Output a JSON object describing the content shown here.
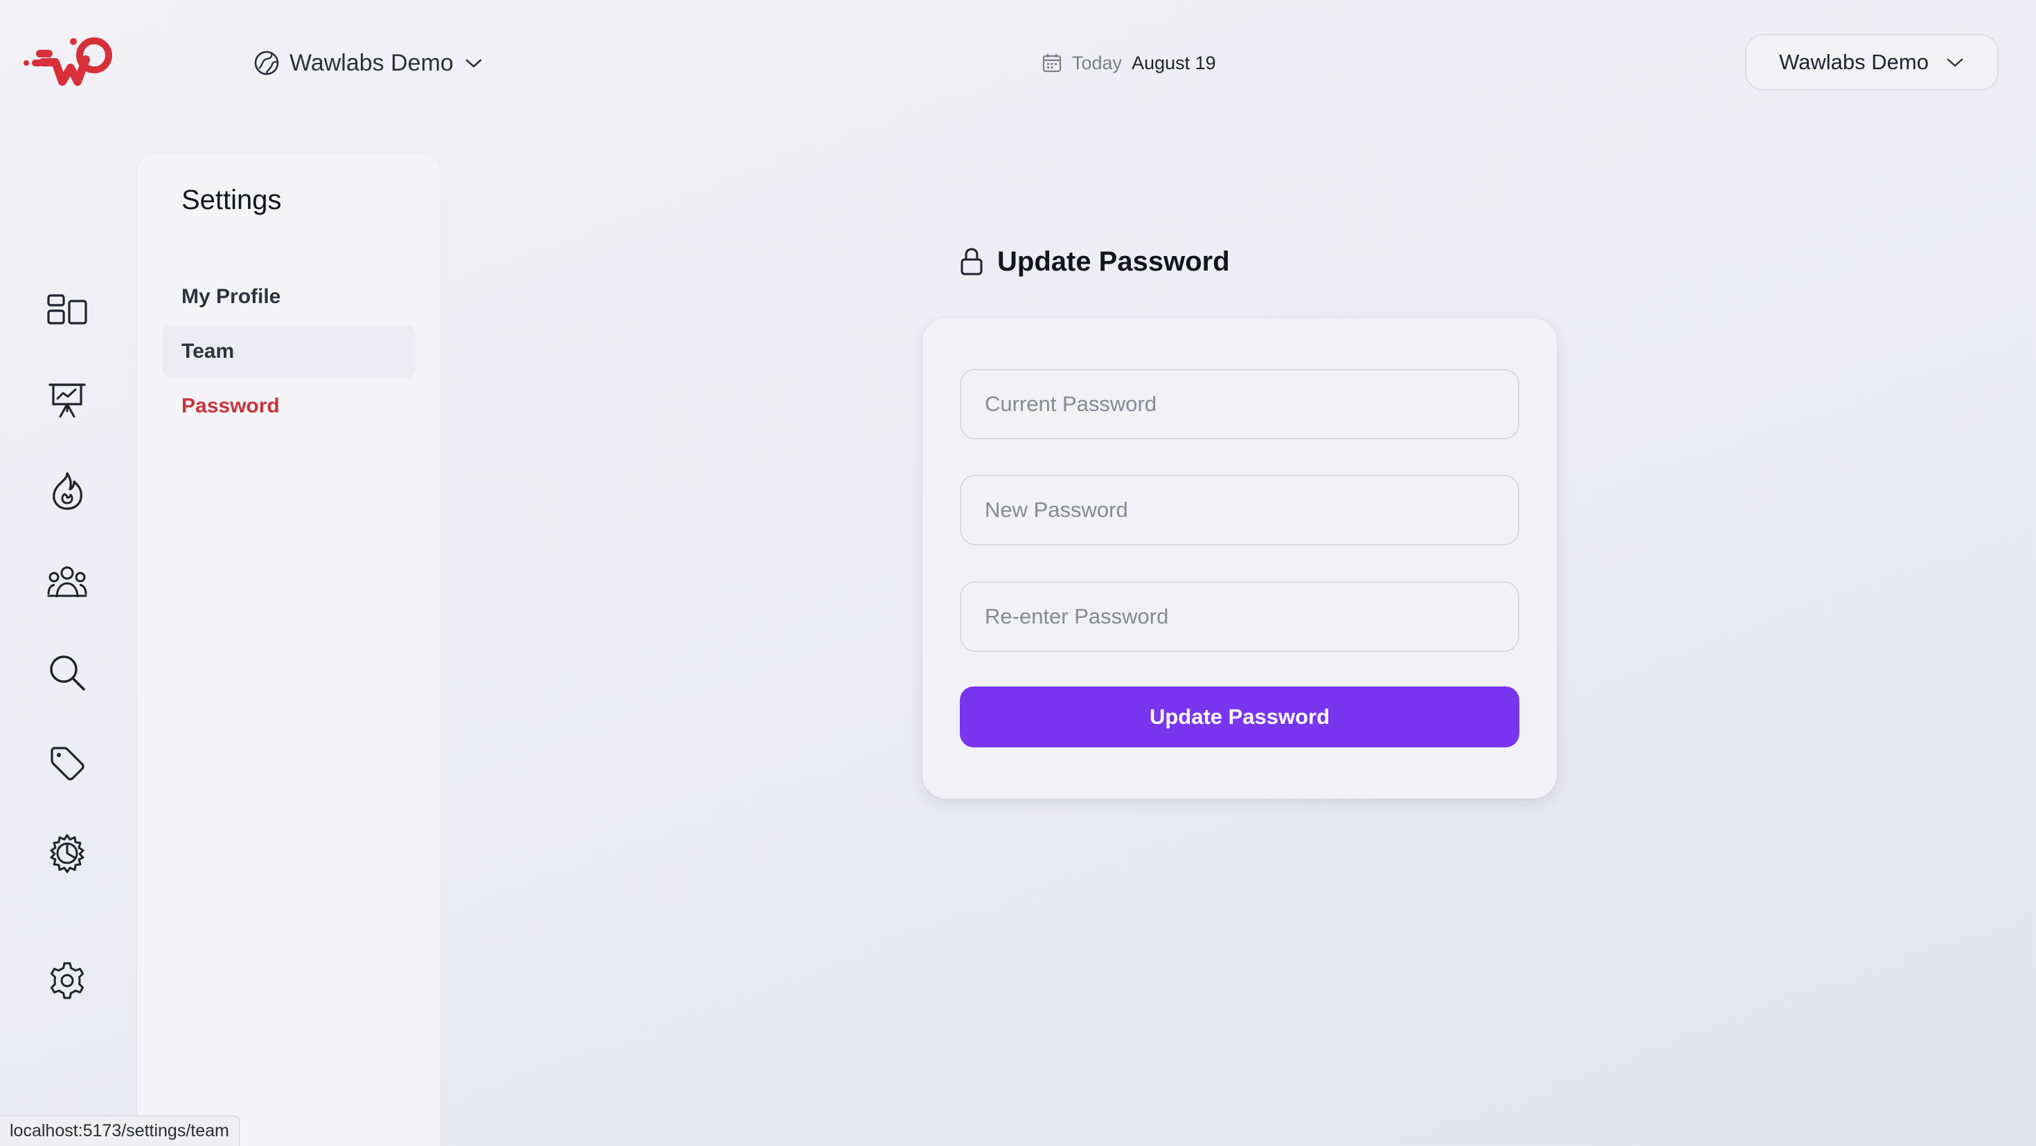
{
  "colors": {
    "brand": "#d7303a",
    "accent": "#7a35ef",
    "active_menu": "#c8343a"
  },
  "header": {
    "logo_icon": "wawlabs-logo-icon",
    "workspace": {
      "icon": "workspace-globe-icon",
      "label": "Wawlabs Demo"
    },
    "date": {
      "icon": "calendar-icon",
      "today_label": "Today",
      "value": "August 19"
    },
    "account": {
      "label": "Wawlabs Demo",
      "icon": "chevron-down-icon"
    }
  },
  "rail": {
    "items": [
      {
        "icon": "dashboard-icon"
      },
      {
        "icon": "presentation-chart-icon"
      },
      {
        "icon": "fire-icon"
      },
      {
        "icon": "users-group-icon"
      },
      {
        "icon": "search-icon"
      },
      {
        "icon": "tag-icon"
      },
      {
        "icon": "gear-badge-icon"
      },
      {
        "icon": "settings-icon"
      }
    ]
  },
  "settings": {
    "title": "Settings",
    "menu": [
      {
        "label": "My Profile",
        "state": "default"
      },
      {
        "label": "Team",
        "state": "hover"
      },
      {
        "label": "Password",
        "state": "active"
      }
    ]
  },
  "password_form": {
    "title": "Update Password",
    "title_icon": "lock-icon",
    "current_placeholder": "Current Password",
    "current_value": "",
    "new_placeholder": "New Password",
    "new_value": "",
    "reenter_placeholder": "Re-enter Password",
    "reenter_value": "",
    "submit_label": "Update Password"
  },
  "status_bar": {
    "url": "localhost:5173/settings/team"
  }
}
